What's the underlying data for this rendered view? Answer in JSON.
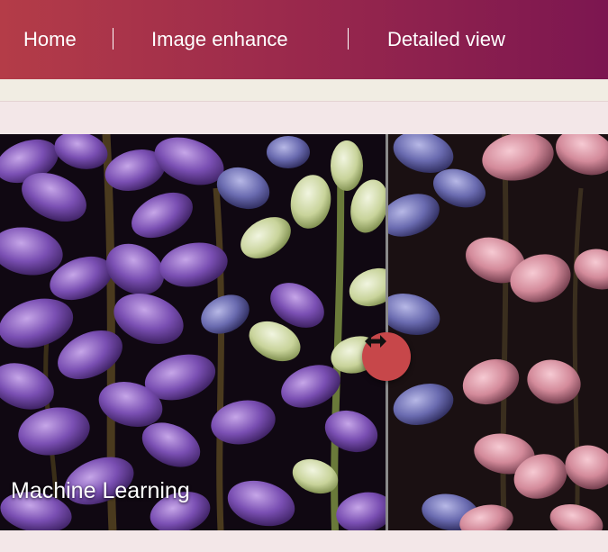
{
  "nav": {
    "home_label": "Home",
    "enhance_label": "Image enhance",
    "detail_label": "Detailed view"
  },
  "viewer": {
    "caption": "Machine Learning",
    "handle_icon": "arrows-left-right-icon"
  },
  "colors": {
    "nav_start": "#b43c48",
    "nav_end": "#7c1650",
    "handle": "#c7474a",
    "page_bg": "#f3e7e8"
  }
}
